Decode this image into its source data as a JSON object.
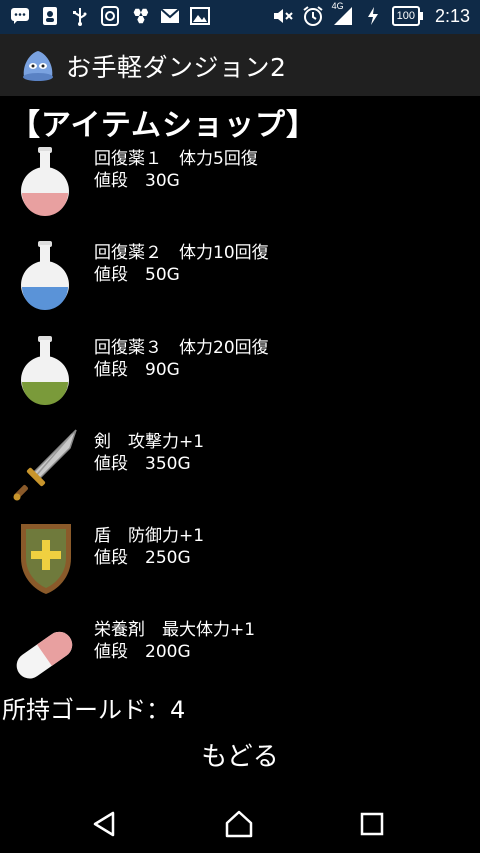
{
  "statusbar": {
    "network": "4G",
    "battery": "100",
    "time": "2:13"
  },
  "app": {
    "title": "お手軽ダンジョン2"
  },
  "shop": {
    "title": "【アイテムショップ】",
    "items": [
      {
        "name": "回復薬１　体力5回復",
        "price": "値段　30G",
        "icon": "potion-red-icon",
        "liquid_color": "#e8a0a0"
      },
      {
        "name": "回復薬２　体力10回復",
        "price": "値段　50G",
        "icon": "potion-blue-icon",
        "liquid_color": "#5a93d8"
      },
      {
        "name": "回復薬３　体力20回復",
        "price": "値段　90G",
        "icon": "potion-green-icon",
        "liquid_color": "#7a9a3a"
      },
      {
        "name": "剣　攻撃力+1",
        "price": "値段　350G",
        "icon": "sword-icon"
      },
      {
        "name": "盾　防御力+1",
        "price": "値段　250G",
        "icon": "shield-icon"
      },
      {
        "name": "栄養剤　最大体力+1",
        "price": "値段　200G",
        "icon": "capsule-icon"
      }
    ]
  },
  "gold": {
    "label": "所持ゴールド：4"
  },
  "back": {
    "label": "もどる"
  },
  "colors": {
    "statusbar": "#0f2a47",
    "appbar": "#202020",
    "background": "#000000"
  }
}
